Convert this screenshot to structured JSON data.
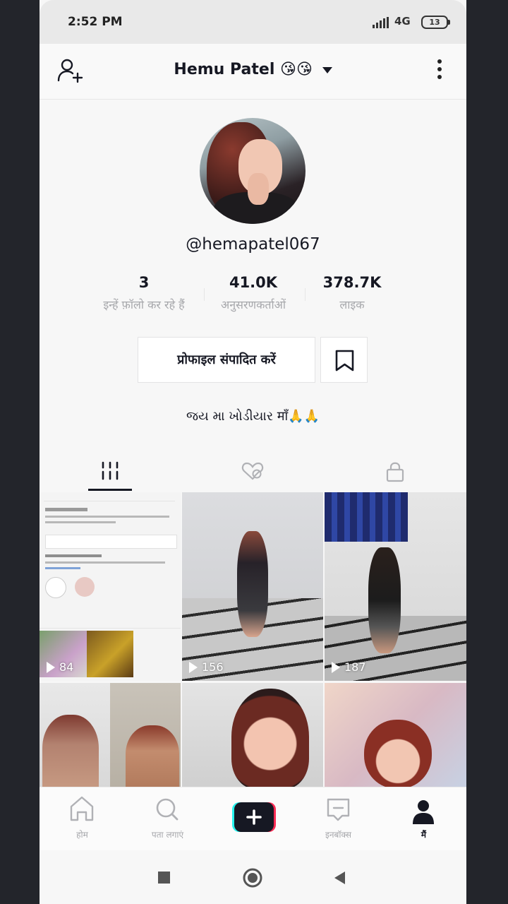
{
  "status": {
    "time": "2:52 PM",
    "network": "4G",
    "battery": "13"
  },
  "header": {
    "name": "Hemu Patel",
    "emoji": "😘😘"
  },
  "profile": {
    "handle": "@hemapatel067",
    "bio": "જય મા ખોડીયાર माँ🙏🙏"
  },
  "stats": [
    {
      "value": "3",
      "label": "इन्हें फ़ॉलो कर रहे हैं"
    },
    {
      "value": "41.0K",
      "label": "अनुसरणकर्ताओं"
    },
    {
      "value": "378.7K",
      "label": "लाइक"
    }
  ],
  "actions": {
    "edit_profile": "प्रोफाइल संपादित करें"
  },
  "videos": [
    {
      "views": "84"
    },
    {
      "views": "156"
    },
    {
      "views": "187"
    }
  ],
  "nav": [
    {
      "label": "होम"
    },
    {
      "label": "पता लगाएं"
    },
    {
      "label": ""
    },
    {
      "label": "इनबॉक्स"
    },
    {
      "label": "मैं"
    }
  ],
  "colors": {
    "accent_pink": "#fe2c55",
    "accent_cyan": "#25f4ee",
    "text": "#161823"
  }
}
